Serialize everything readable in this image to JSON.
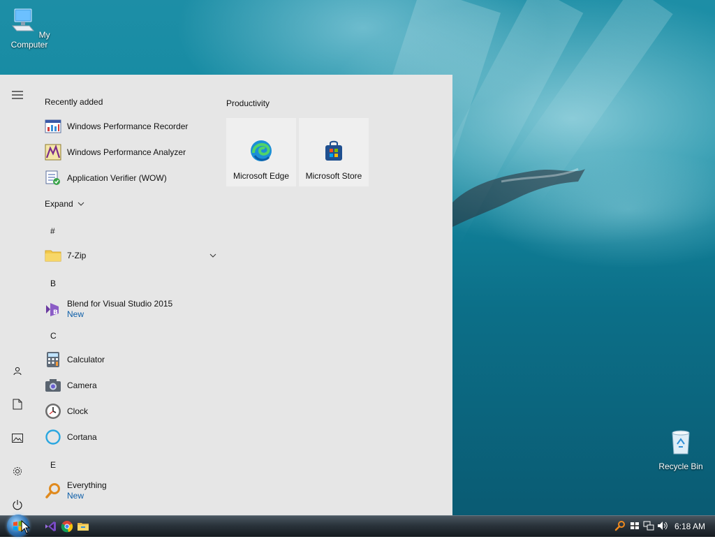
{
  "desktop": {
    "icons": [
      {
        "label": "My Computer"
      },
      {
        "label": "Recycle Bin"
      }
    ]
  },
  "start_menu": {
    "recently_added_header": "Recently added",
    "recent": [
      {
        "label": "Windows Performance Recorder"
      },
      {
        "label": "Windows Performance Analyzer"
      },
      {
        "label": "Application Verifier (WOW)"
      }
    ],
    "expand_label": "Expand",
    "sections": [
      {
        "letter": "#"
      },
      {
        "letter": "B"
      },
      {
        "letter": "C"
      },
      {
        "letter": "E"
      }
    ],
    "apps": [
      {
        "label": "7-Zip"
      },
      {
        "label": "Blend for Visual Studio 2015",
        "sub": "New"
      },
      {
        "label": "Calculator"
      },
      {
        "label": "Camera"
      },
      {
        "label": "Clock"
      },
      {
        "label": "Cortana"
      },
      {
        "label": "Everything",
        "sub": "New"
      }
    ],
    "tiles_header": "Productivity",
    "tiles": [
      {
        "label": "Microsoft Edge"
      },
      {
        "label": "Microsoft Store"
      }
    ]
  },
  "taskbar": {
    "clock": "6:18 AM"
  },
  "colors": {
    "menu_bg": "#e6e6e6",
    "accent_new": "#0d5ea8"
  }
}
